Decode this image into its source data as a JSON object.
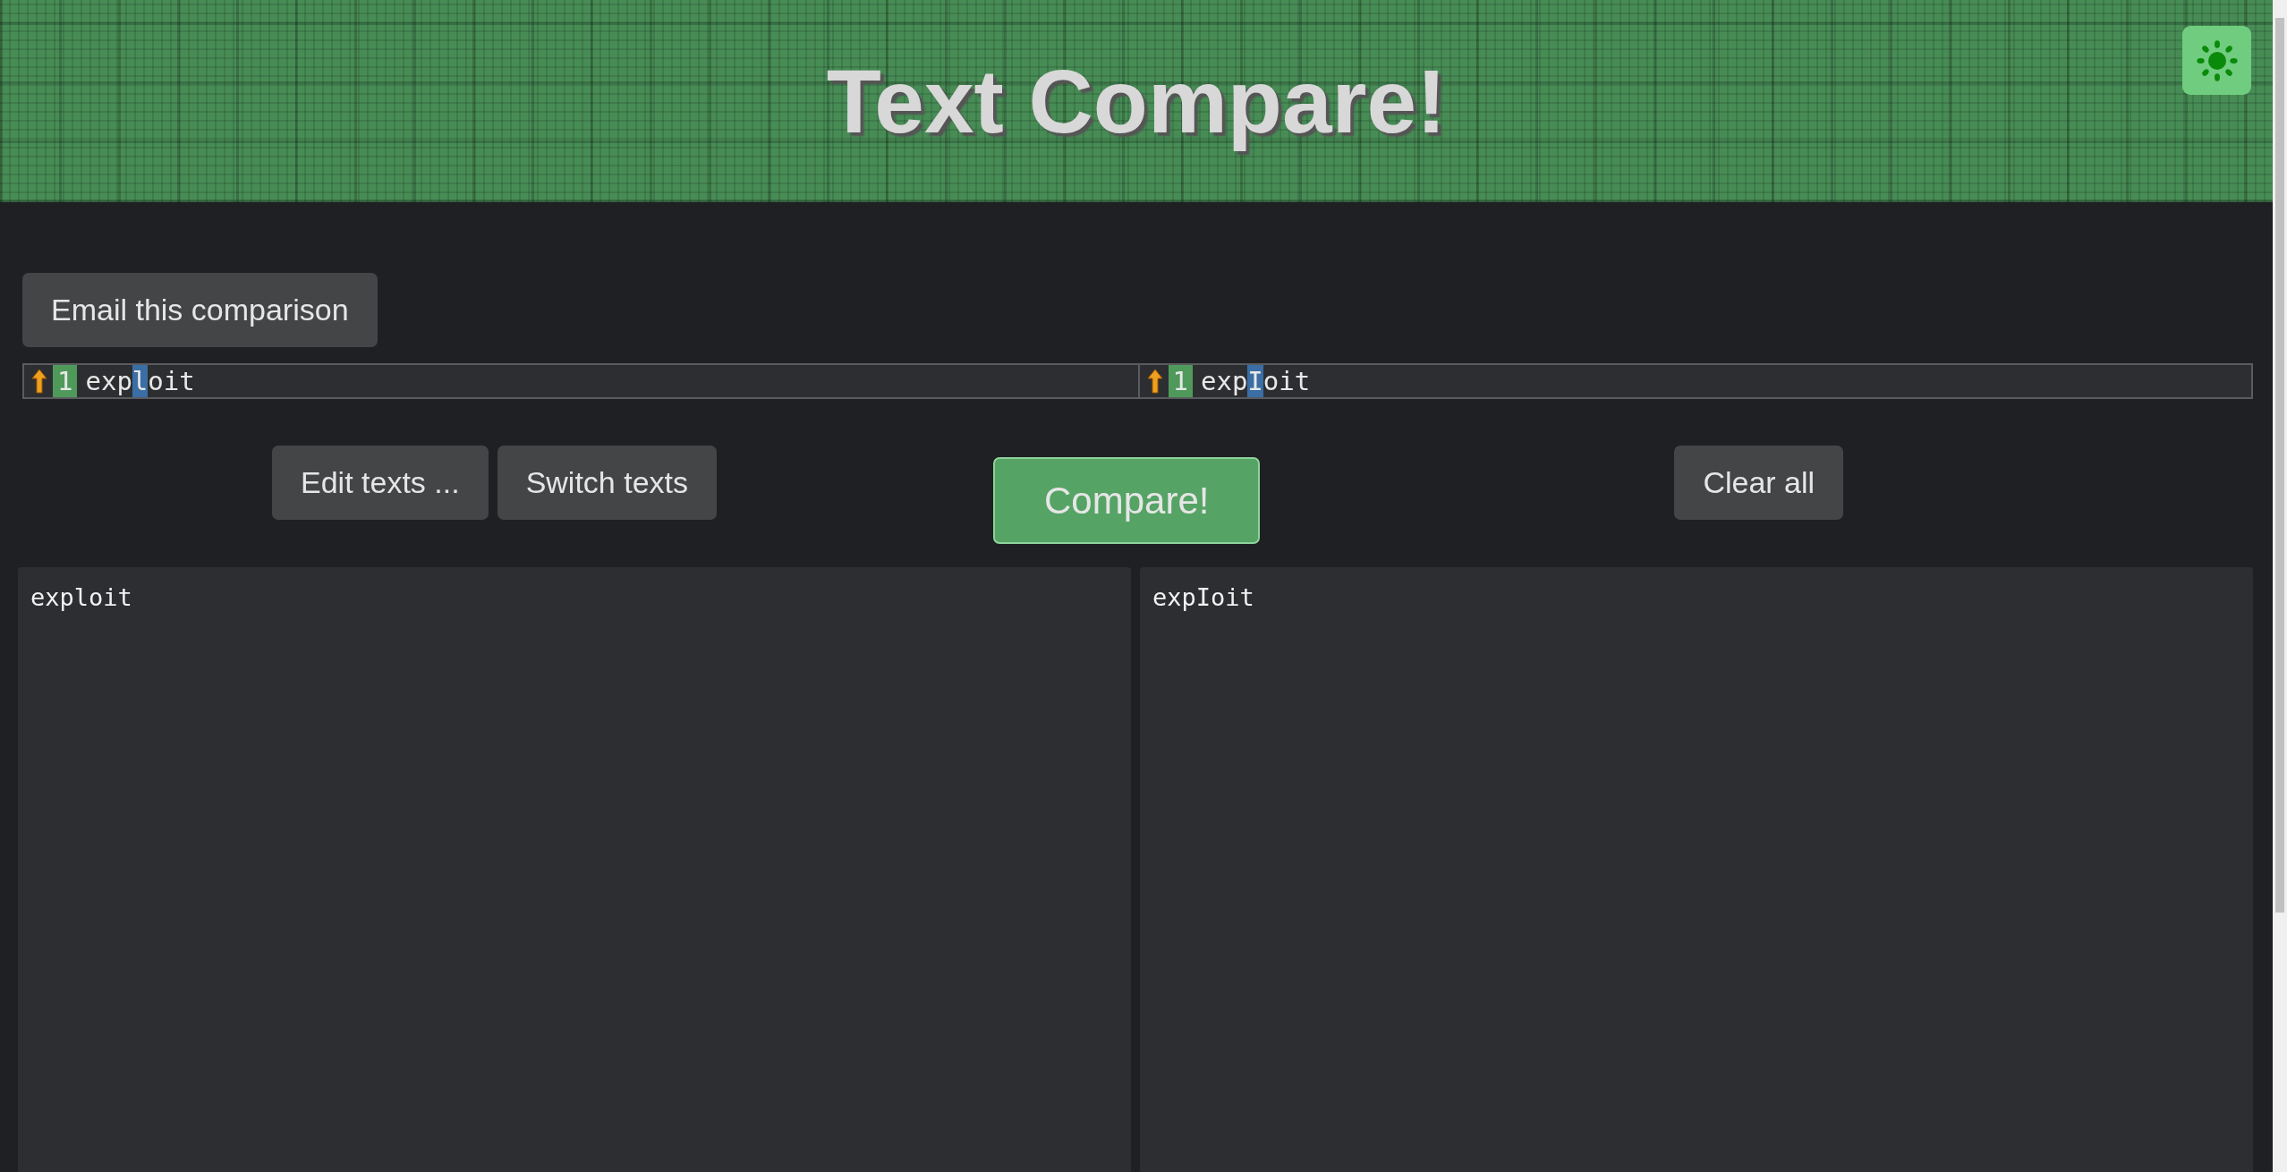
{
  "header": {
    "title": "Text Compare!",
    "theme_toggle": {
      "on": true
    }
  },
  "email_button": "Email this comparison",
  "diff": [
    {
      "line_number": "1",
      "segments": [
        {
          "text": "exp",
          "changed": false
        },
        {
          "text": "l",
          "changed": true
        },
        {
          "text": "oit",
          "changed": false
        }
      ]
    },
    {
      "line_number": "1",
      "segments": [
        {
          "text": "exp",
          "changed": false
        },
        {
          "text": "I",
          "changed": true
        },
        {
          "text": "oit",
          "changed": false
        }
      ]
    }
  ],
  "buttons": {
    "edit": "Edit texts ...",
    "switch": "Switch texts",
    "compare": "Compare!",
    "clear": "Clear all"
  },
  "texts": [
    {
      "value": "exploit"
    },
    {
      "value": "expIoit"
    }
  ]
}
